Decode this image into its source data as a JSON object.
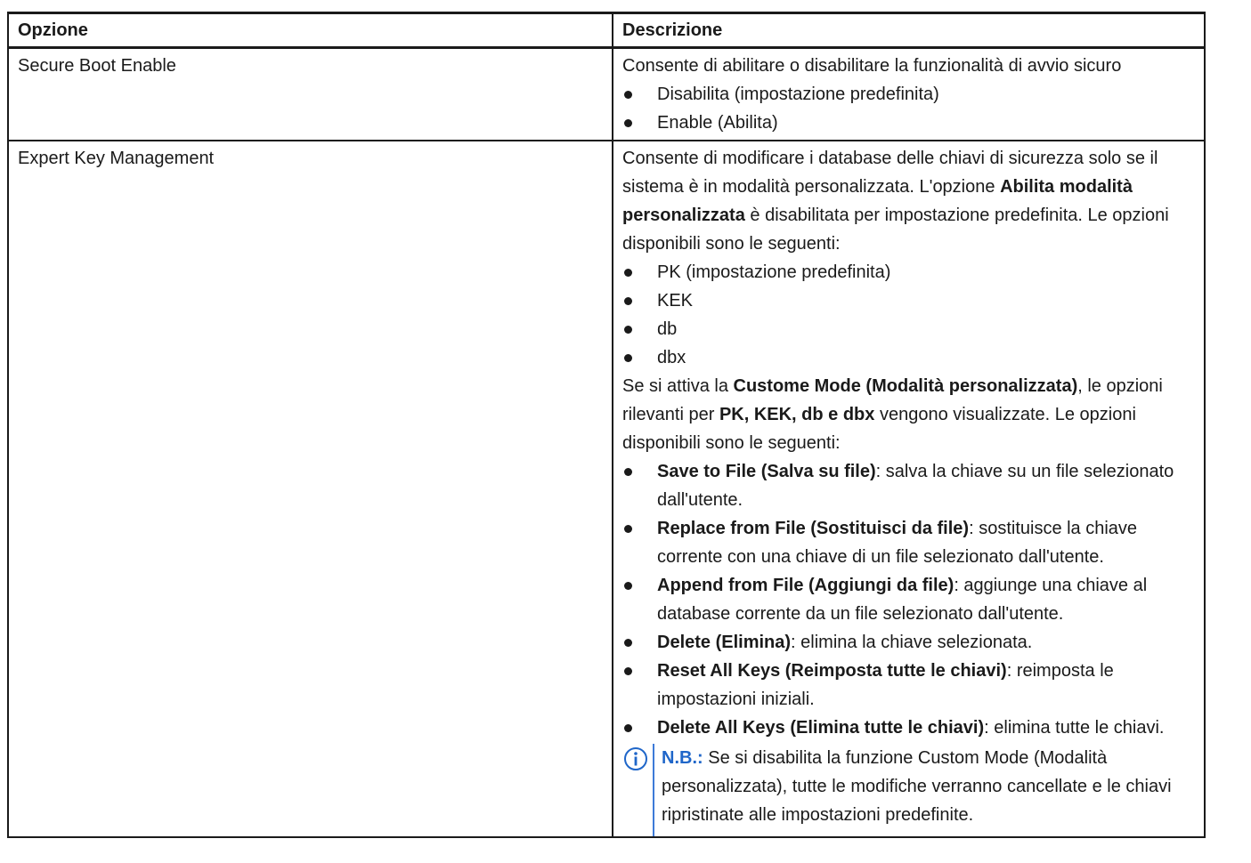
{
  "header": {
    "col1": "Opzione",
    "col2": "Descrizione"
  },
  "rows": [
    {
      "option": "Secure Boot Enable",
      "intro": "Consente di abilitare o disabilitare la funzionalità di avvio sicuro",
      "bullets": [
        "Disabilita (impostazione predefinita)",
        "Enable (Abilita)"
      ]
    },
    {
      "option": "Expert Key Management",
      "intro_pre": "Consente di modificare i database delle chiavi di sicurezza solo se il sistema è in modalità personalizzata. L'opzione ",
      "intro_bold": "Abilita modalità personalizzata",
      "intro_post": " è disabilitata per impostazione predefinita. Le opzioni disponibili sono le seguenti:",
      "bullets1": [
        "PK (impostazione predefinita)",
        "KEK",
        "db",
        "dbx"
      ],
      "para2_pre": "Se si attiva la ",
      "para2_bold1": "Custome Mode (Modalità personalizzata)",
      "para2_mid": ", le opzioni rilevanti per ",
      "para2_bold2": "PK, KEK, db e dbx",
      "para2_post": " vengono visualizzate. Le opzioni disponibili sono le seguenti:",
      "bullets2": [
        {
          "term": "Save to File (Salva su file)",
          "desc": ": salva la chiave su un file selezionato dall'utente."
        },
        {
          "term": "Replace from File (Sostituisci da file)",
          "desc": ": sostituisce la chiave corrente con una chiave di un file selezionato dall'utente."
        },
        {
          "term": "Append from File (Aggiungi da file)",
          "desc": ": aggiunge una chiave al database corrente da un file selezionato dall'utente."
        },
        {
          "term": "Delete (Elimina)",
          "desc": ": elimina la chiave selezionata."
        },
        {
          "term": "Reset All Keys (Reimposta tutte le chiavi)",
          "desc": ": reimposta le impostazioni iniziali."
        },
        {
          "term": "Delete All Keys (Elimina tutte le chiavi)",
          "desc": ": elimina tutte le chiavi."
        }
      ],
      "note_label": "N.B.:",
      "note_text": " Se si disabilita la funzione Custom Mode (Modalità personalizzata), tutte le modifiche verranno cancellate e le chiavi ripristinate alle impostazioni predefinite."
    }
  ],
  "colors": {
    "note_accent": "#1f66c9",
    "note_bar": "#3d7ad8",
    "text": "#1a1a1a"
  },
  "icons": {
    "note": "info-icon"
  }
}
